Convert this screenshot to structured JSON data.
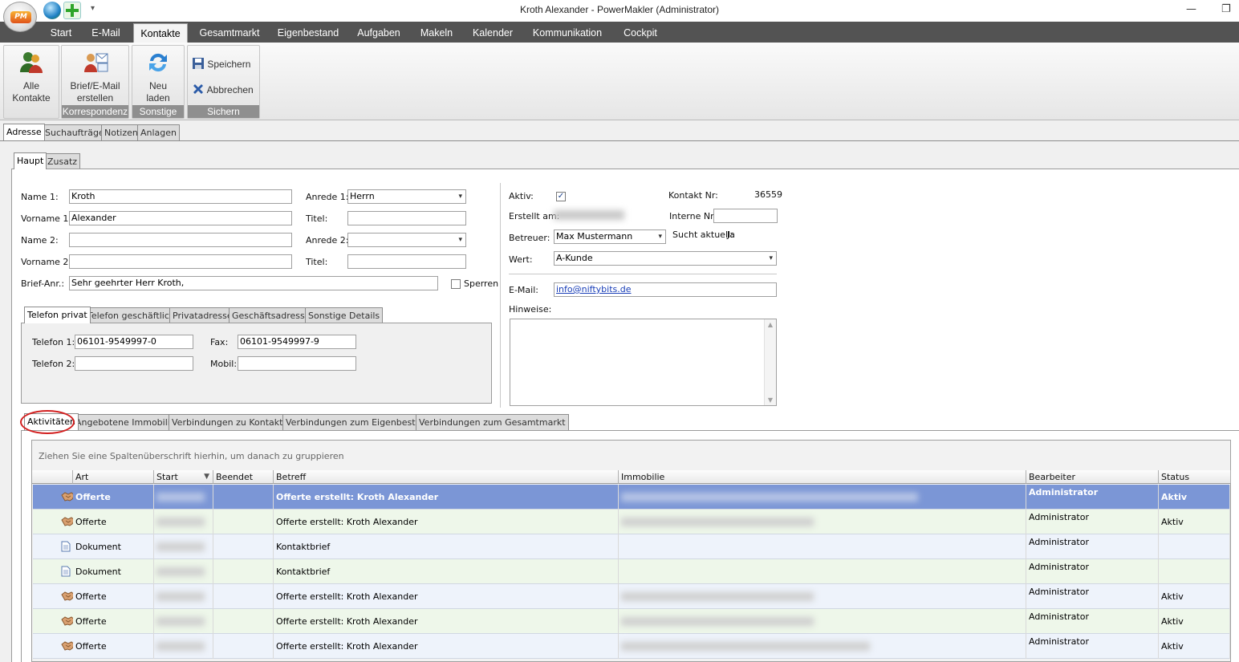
{
  "window": {
    "title": "Kroth Alexander - PowerMakler (Administrator)",
    "app_logo_text": "PM"
  },
  "menu": [
    "Start",
    "E-Mail",
    "Kontakte",
    "Gesamtmarkt",
    "Eigenbestand",
    "Aufgaben",
    "Makeln",
    "Kalender",
    "Kommunikation",
    "Cockpit"
  ],
  "ribbon": {
    "alle_kontakte": [
      "Alle",
      "Kontakte"
    ],
    "brief": [
      "Brief/E-Mail",
      "erstellen"
    ],
    "neu_laden": [
      "Neu",
      "laden"
    ],
    "speichern": "Speichern",
    "abbrechen": "Abbrechen",
    "group_korrespondenz": "Korrespondenz",
    "group_sonstige": "Sonstige",
    "group_sichern": "Sichern"
  },
  "main_tabs": [
    "Adresse",
    "Suchaufträge",
    "Notizen",
    "Anlagen"
  ],
  "sub_tabs": [
    "Haupt",
    "Zusatz"
  ],
  "form": {
    "name1_label": "Name 1:",
    "name1": "Kroth",
    "vorname1_label": "Vorname 1:",
    "vorname1": "Alexander",
    "name2_label": "Name 2:",
    "name2": "",
    "vorname2_label": "Vorname 2:",
    "vorname2": "",
    "briefanr_label": "Brief-Anr.:",
    "briefanr": "Sehr geehrter Herr Kroth,",
    "anrede1_label": "Anrede 1:",
    "anrede1": "Herrn",
    "titel1_label": "Titel:",
    "titel1": "",
    "anrede2_label": "Anrede 2:",
    "anrede2": "",
    "titel2_label": "Titel:",
    "titel2": "",
    "sperren_label": "Sperren"
  },
  "phone_tabs": [
    "Telefon privat",
    "Telefon geschäftlich",
    "Privatadresse",
    "Geschäftsadresse",
    "Sonstige Details"
  ],
  "phone": {
    "tel1_label": "Telefon 1:",
    "tel1": "06101-9549997-0",
    "tel2_label": "Telefon 2:",
    "tel2": "",
    "fax_label": "Fax:",
    "fax": "06101-9549997-9",
    "mobil_label": "Mobil:",
    "mobil": ""
  },
  "right": {
    "aktiv_label": "Aktiv:",
    "erstellt_label": "Erstellt am:",
    "betreuer_label": "Betreuer:",
    "betreuer": "Max Mustermann",
    "wert_label": "Wert:",
    "wert": "A-Kunde",
    "kontakt_nr_label": "Kontakt Nr:",
    "kontakt_nr": "36559",
    "interne_nr_label": "Interne Nr:",
    "interne_nr": "",
    "sucht_label": "Sucht aktuell:",
    "sucht": "Ja",
    "email_label": "E-Mail:",
    "email": "info@niftybits.de",
    "hinweise_label": "Hinweise:"
  },
  "bottom_tabs": [
    "Aktivitäten",
    "Angebotene Immobilien",
    "Verbindungen zu Kontakten",
    "Verbindungen zum Eigenbestand",
    "Verbindungen zum Gesamtmarkt"
  ],
  "grid": {
    "group_hint": "Ziehen Sie eine Spaltenüberschrift hierhin, um danach zu gruppieren",
    "columns": [
      "Art",
      "Start",
      "Beendet",
      "Betreff",
      "Immobilie",
      "Bearbeiter",
      "Status"
    ],
    "rows": [
      {
        "icon": "handshake-icon",
        "art": "Offerte",
        "betreff": "Offerte erstellt: Kroth  Alexander",
        "bearbeiter": "Administrator",
        "status": "Aktiv"
      },
      {
        "icon": "handshake-icon",
        "art": "Offerte",
        "betreff": "Offerte erstellt: Kroth  Alexander",
        "bearbeiter": "Administrator",
        "status": "Aktiv"
      },
      {
        "icon": "document-icon",
        "art": "Dokument",
        "betreff": "Kontaktbrief",
        "bearbeiter": "Administrator",
        "status": ""
      },
      {
        "icon": "document-icon",
        "art": "Dokument",
        "betreff": "Kontaktbrief",
        "bearbeiter": "Administrator",
        "status": ""
      },
      {
        "icon": "handshake-icon",
        "art": "Offerte",
        "betreff": "Offerte erstellt: Kroth  Alexander",
        "bearbeiter": "Administrator",
        "status": "Aktiv"
      },
      {
        "icon": "handshake-icon",
        "art": "Offerte",
        "betreff": "Offerte erstellt: Kroth  Alexander",
        "bearbeiter": "Administrator",
        "status": "Aktiv"
      },
      {
        "icon": "handshake-icon",
        "art": "Offerte",
        "betreff": "Offerte erstellt: Kroth  Alexander",
        "bearbeiter": "Administrator",
        "status": "Aktiv"
      }
    ]
  },
  "colors": {
    "menubar": "#535353",
    "selected_row": "#7b96d6",
    "row_alt_a": "#eef3fb",
    "row_alt_b": "#eef7ea",
    "highlight_circle": "#d21f1f"
  }
}
